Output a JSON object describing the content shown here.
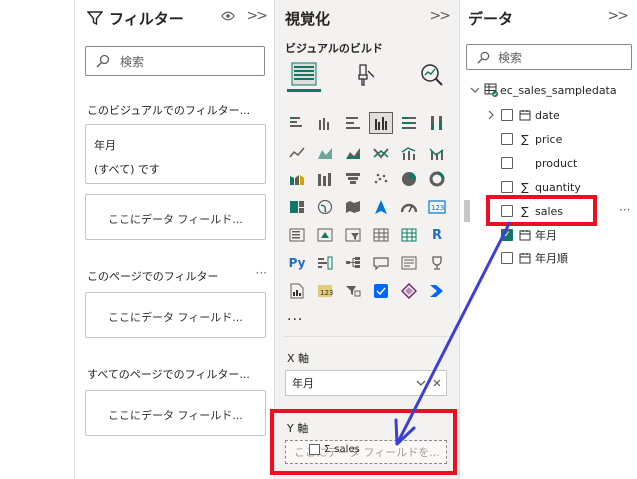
{
  "filters_pane": {
    "title": "フィルター",
    "eye_icon": "eye-icon",
    "collapse_label": ">>",
    "search_placeholder": "検索",
    "this_visual_section": "このビジュアルでのフィルター...",
    "filter_card": {
      "field": "年月",
      "value": "(すべて) です"
    },
    "drop_here_1": "ここにデータ フィールド...",
    "this_page_section": "このページでのフィルター",
    "drop_here_2": "ここにデータ フィールド...",
    "all_pages_section": "すべてのページでのフィルター...",
    "drop_here_3": "ここにデータ フィールド...",
    "section_more": "···"
  },
  "visualizations_pane": {
    "title": "視覚化",
    "collapse_label": ">>",
    "build_label": "ビジュアルのビルド",
    "more_visuals": "...",
    "x_axis_label": "X 軸",
    "x_axis_field": "年月",
    "y_axis_label": "Y 軸",
    "y_axis_placeholder": "ここにデータ フィールドを...",
    "drag_chip": "sales",
    "drag_sigma": "Σ"
  },
  "data_pane": {
    "title": "データ",
    "collapse_label": ">>",
    "search_placeholder": "検索",
    "table_name": "ec_sales_sampledata",
    "fields": [
      {
        "name": "date",
        "type": "calendar",
        "checked": false,
        "expandable": true
      },
      {
        "name": "price",
        "type": "sigma",
        "checked": false
      },
      {
        "name": "product",
        "type": "none",
        "checked": false
      },
      {
        "name": "quantity",
        "type": "sigma",
        "checked": false
      },
      {
        "name": "sales",
        "type": "sigma",
        "checked": false
      },
      {
        "name": "年月",
        "type": "calendar",
        "checked": true
      },
      {
        "name": "年月順",
        "type": "calendar",
        "checked": false
      }
    ],
    "row_more": "···"
  },
  "colors": {
    "accent": "#117865",
    "highlight": "#e81123",
    "arrow": "#3b3fd8"
  }
}
